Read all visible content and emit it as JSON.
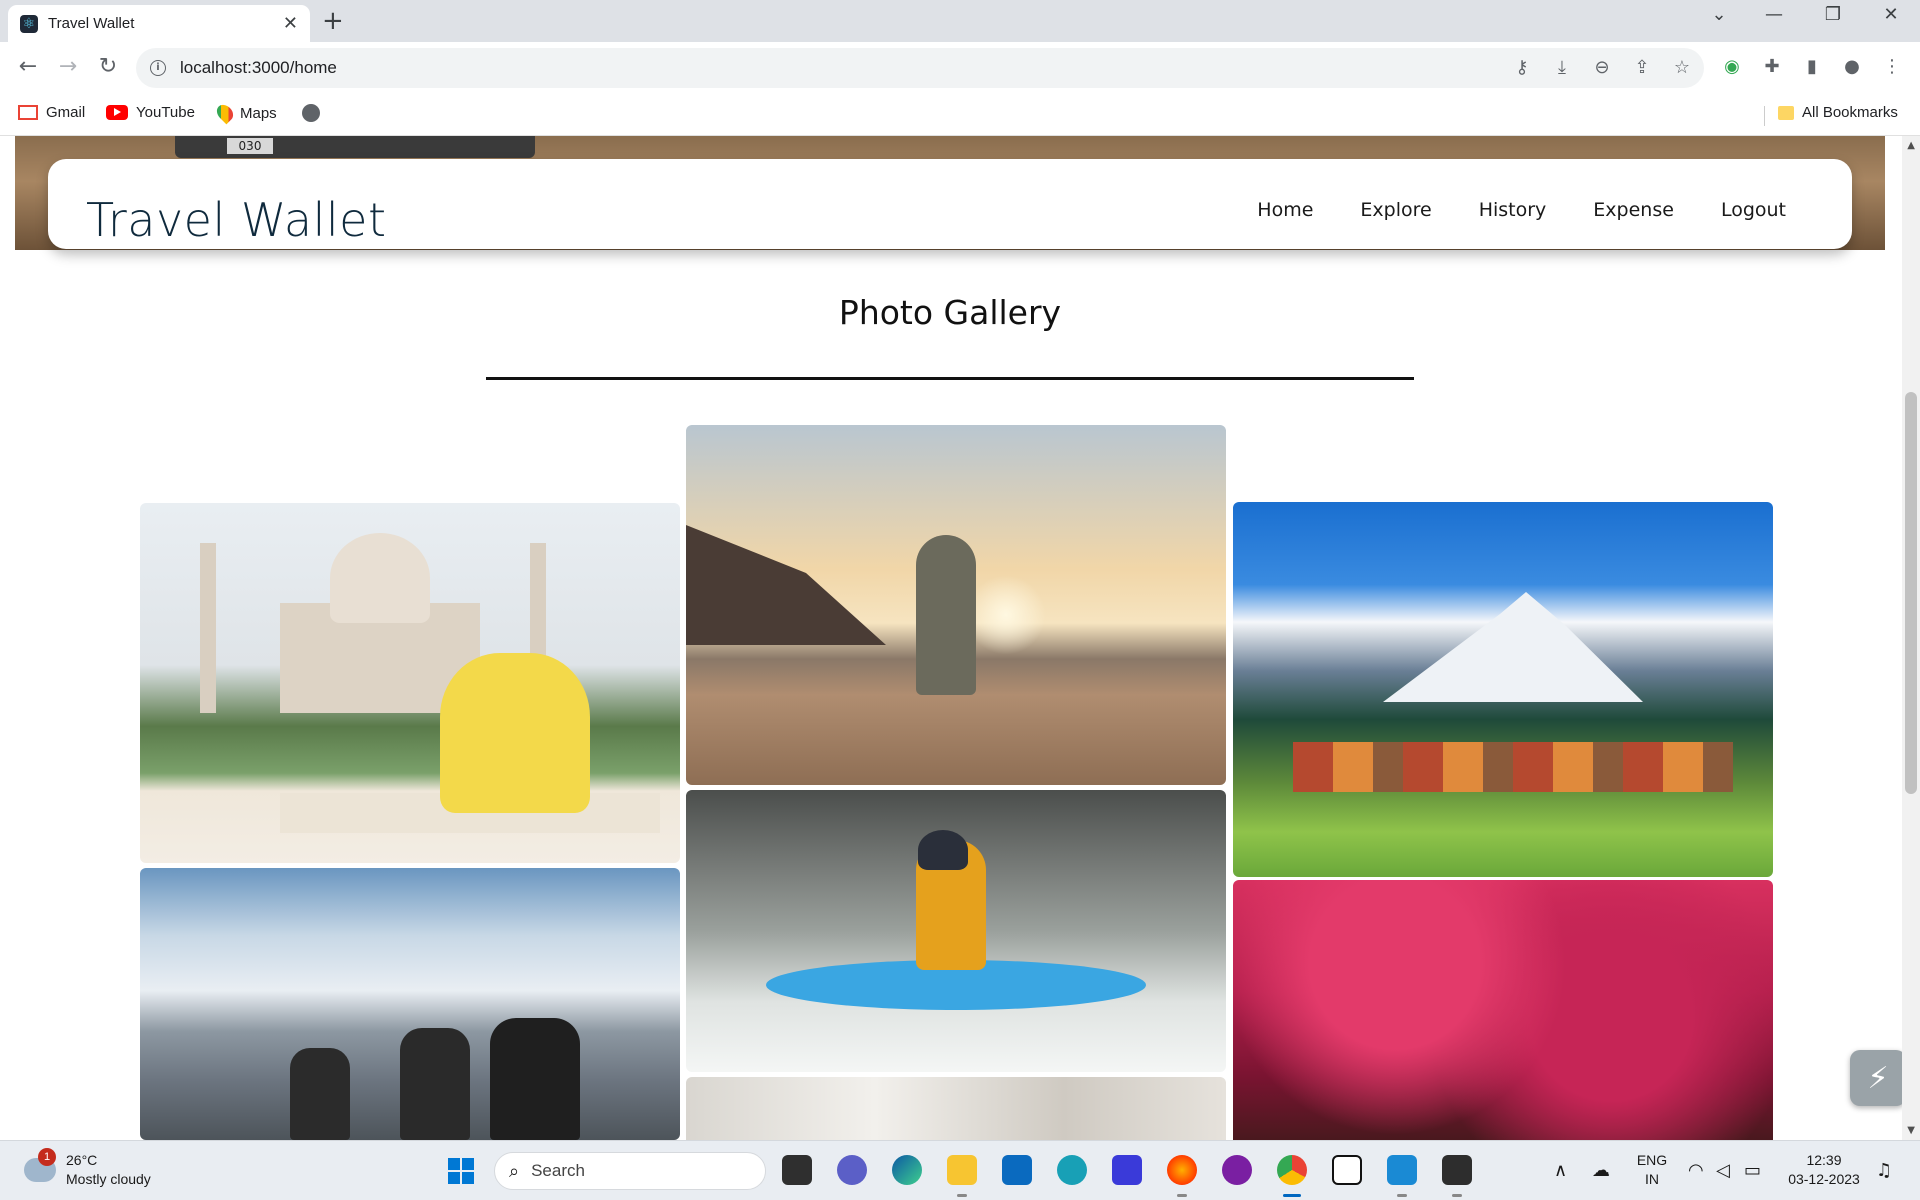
{
  "browser": {
    "tab_title": "Travel Wallet",
    "url": "localhost:3000/home",
    "bookmarks": [
      {
        "label": "Gmail",
        "icon": "gmail-icon"
      },
      {
        "label": "YouTube",
        "icon": "youtube-icon"
      },
      {
        "label": "Maps",
        "icon": "maps-icon"
      }
    ],
    "all_bookmarks_label": "All Bookmarks"
  },
  "site": {
    "hero_plate": "030",
    "brand": "Travel Wallet",
    "nav": [
      {
        "label": "Home"
      },
      {
        "label": "Explore"
      },
      {
        "label": "History"
      },
      {
        "label": "Expense"
      },
      {
        "label": "Logout"
      }
    ],
    "gallery_title": "Photo Gallery",
    "photos": [
      {
        "subject": "taj-mahal"
      },
      {
        "subject": "beach-sunset"
      },
      {
        "subject": "kashmir-valley"
      },
      {
        "subject": "mountain-bikers"
      },
      {
        "subject": "kayaking"
      },
      {
        "subject": "blurred-photo"
      },
      {
        "subject": "cherry-blossom"
      }
    ]
  },
  "taskbar": {
    "weather_badge": "1",
    "temperature": "26°C",
    "weather_desc": "Mostly cloudy",
    "search_placeholder": "Search",
    "language": "ENG",
    "region": "IN",
    "time": "12:39",
    "date": "03-12-2023"
  },
  "colors": {
    "brand_text": "#0f2a3d",
    "accent_blue": "#0067c0"
  }
}
